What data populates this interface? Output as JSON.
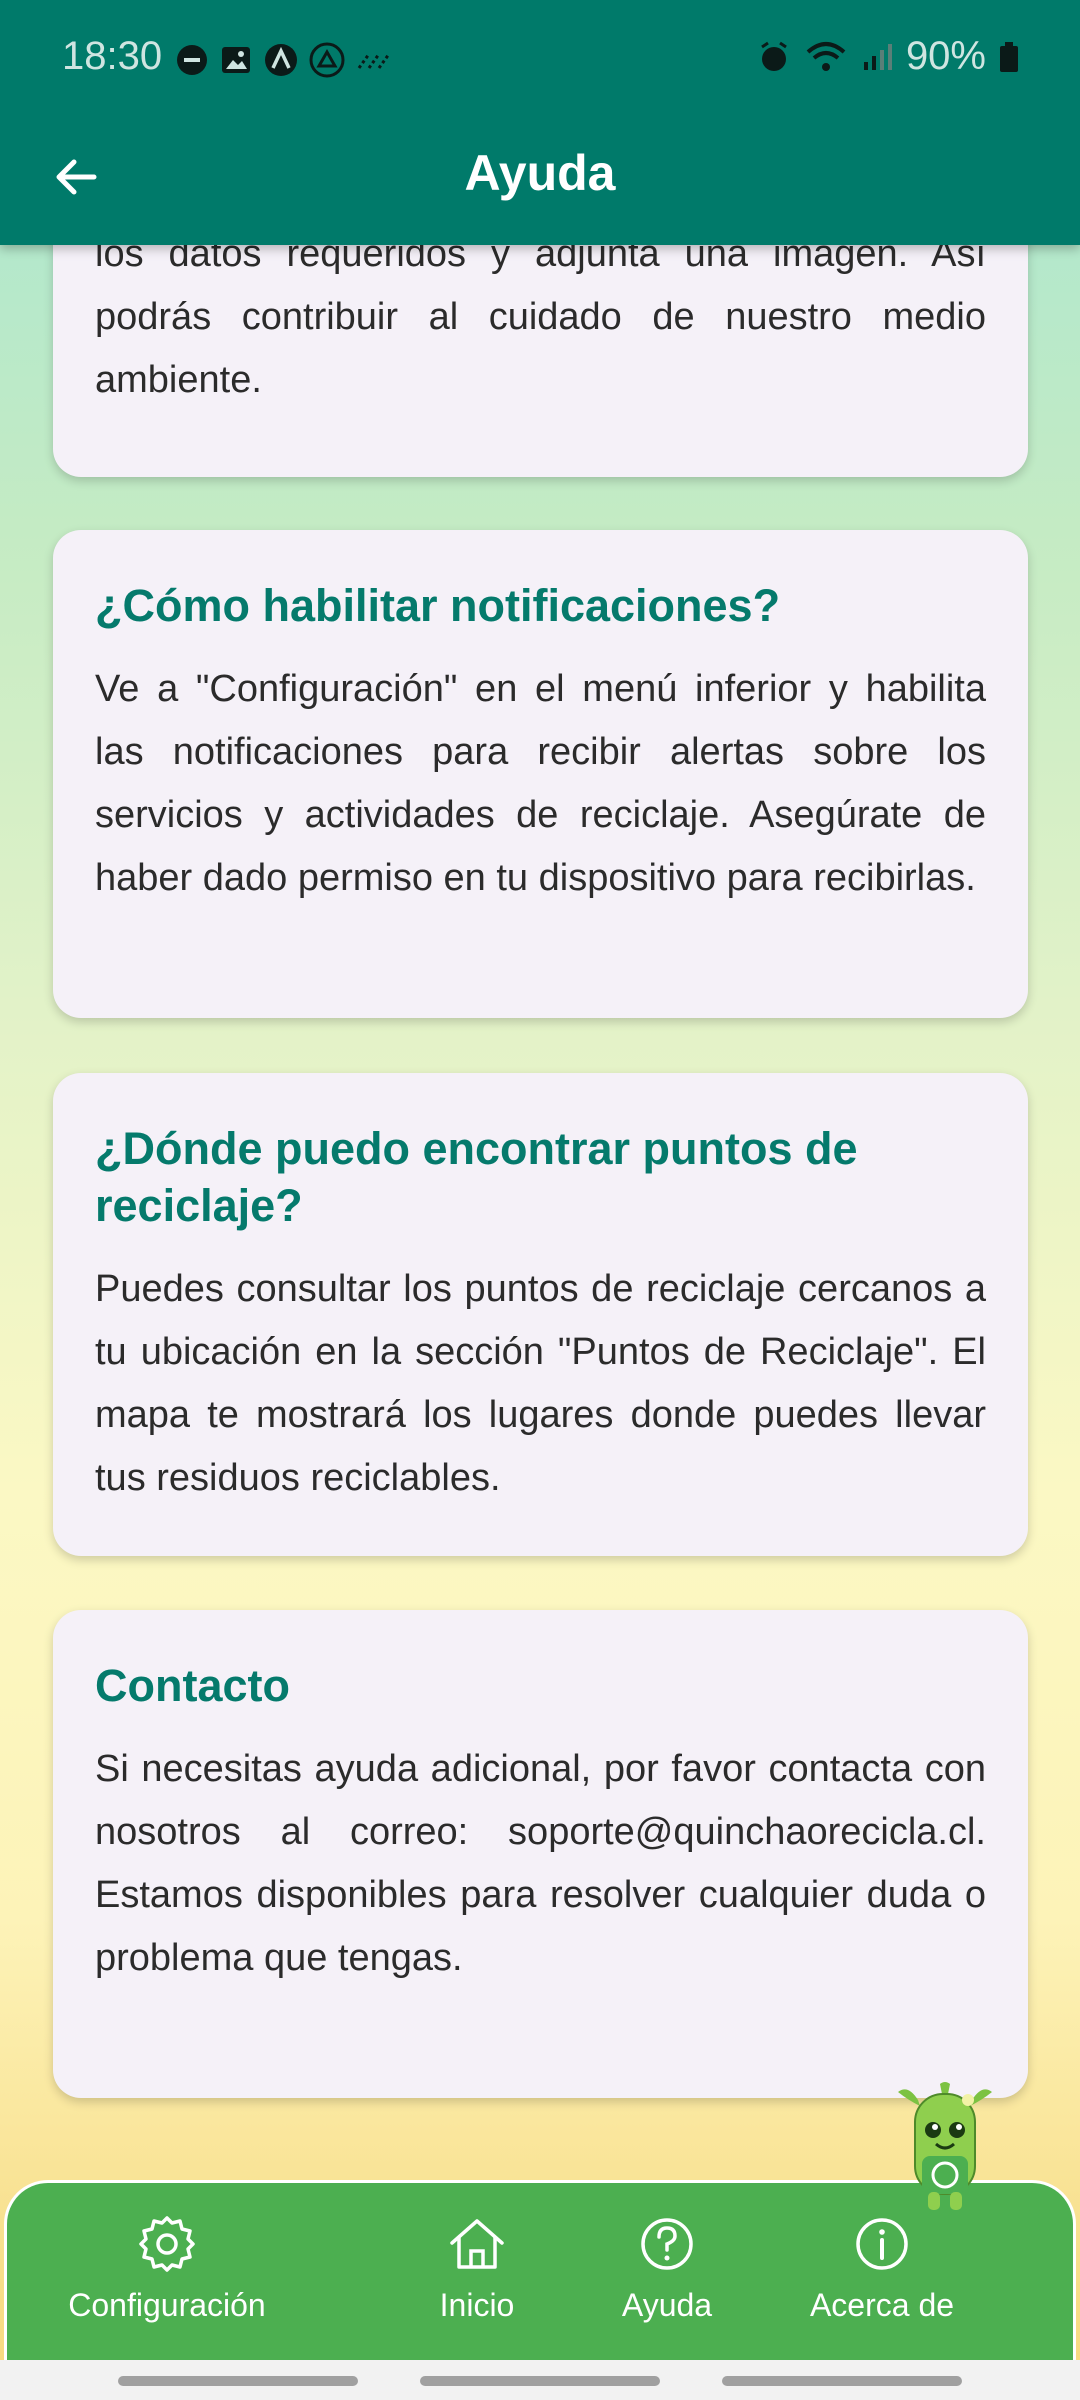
{
  "status_bar": {
    "time": "18:30",
    "battery": "90%"
  },
  "app_bar": {
    "title": "Ayuda"
  },
  "cards": [
    {
      "title": "",
      "body": "los datos requeridos y adjunta una imagen. Así podrás contribuir al cuidado de nuestro medio ambiente."
    },
    {
      "title": "¿Cómo habilitar notificaciones?",
      "body": "Ve a \"Configuración\" en el menú inferior y habilita las notificaciones para recibir alertas sobre los servicios y actividades de reciclaje. Asegúrate de haber dado permiso en tu dispositivo para recibirlas."
    },
    {
      "title": "¿Dónde puedo encontrar puntos de reciclaje?",
      "body": "Puedes consultar los puntos de reciclaje cercanos a tu ubicación en la sección \"Puntos de Reciclaje\". El mapa te mostrará los lugares donde puedes llevar tus residuos reciclables."
    },
    {
      "title": "Contacto",
      "body": "Si necesitas ayuda adicional, por favor contacta con nosotros al correo: soporte@quinchaorecicla.cl. Estamos disponibles para resolver cualquier duda o problema que tengas."
    }
  ],
  "bottom_nav": {
    "items": [
      {
        "label": "Configuración",
        "icon": "gear-icon"
      },
      {
        "label": "Inicio",
        "icon": "home-icon"
      },
      {
        "label": "Ayuda",
        "icon": "help-icon"
      },
      {
        "label": "Acerca de",
        "icon": "info-icon"
      }
    ]
  },
  "colors": {
    "primary": "#007a6a",
    "nav": "#4caf50",
    "heading": "#057a6c",
    "card": "#f5f1f8"
  }
}
